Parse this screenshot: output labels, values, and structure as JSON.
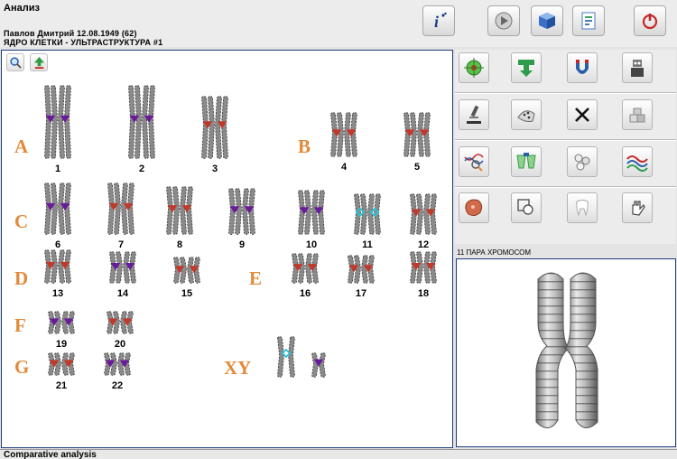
{
  "header": {
    "title": "Анализ",
    "patient": "Павлов  Дмитрий    12.08.1949 (62)",
    "subtitle": "ЯДРО  КЛЕТКИ - УЛЬТРАСТРУКТУРА #1"
  },
  "toolbar": [
    {
      "icon": "info-icon",
      "glyph": "i"
    },
    {
      "icon": "play-icon"
    },
    {
      "icon": "cube-icon"
    },
    {
      "icon": "report-icon"
    },
    {
      "icon": "power-icon"
    }
  ],
  "karyotype": {
    "groups": [
      "A",
      "B",
      "C",
      "D",
      "E",
      "F",
      "G",
      "XY"
    ],
    "chromosomes": [
      "1",
      "2",
      "3",
      "4",
      "5",
      "6",
      "7",
      "8",
      "9",
      "10",
      "11",
      "12",
      "13",
      "14",
      "15",
      "16",
      "17",
      "18",
      "19",
      "20",
      "21",
      "22"
    ]
  },
  "tools": [
    [
      "target-icon",
      "arrows-down-icon",
      "magnet-icon",
      "robot-icon"
    ],
    [
      "microscope-icon",
      "dna-probe-icon",
      "close-icon",
      "cubes-icon"
    ],
    [
      "dna-search-icon",
      "compare-icon",
      "cells-icon",
      "spectrum-icon"
    ],
    [
      "organ-icon",
      "magnify-frame-icon",
      "tooth-icon",
      "hand-tool-icon"
    ]
  ],
  "pair_label": "11 ПАРА ХРОМОСОМ",
  "status": "Comparative analysis",
  "colors": {
    "accent_red": "#c0392b",
    "marker_purple": "#6a1b9a",
    "marker_cyan": "#26c6da",
    "group_letter": "#e38a3a"
  }
}
